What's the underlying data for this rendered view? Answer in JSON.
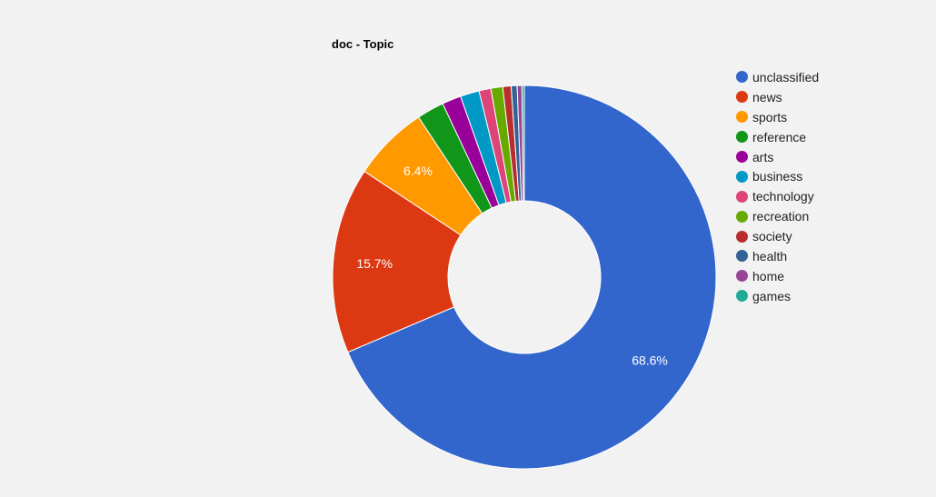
{
  "chart_data": {
    "type": "pie",
    "variant": "donut",
    "title": "doc - Topic",
    "legend_position": "right",
    "slices": [
      {
        "label": "unclassified",
        "value": 68.6,
        "color": "#3366cc",
        "data_label": "68.6%"
      },
      {
        "label": "news",
        "value": 15.7,
        "color": "#dc3912",
        "data_label": "15.7%"
      },
      {
        "label": "sports",
        "value": 6.4,
        "color": "#ff9900",
        "data_label": "6.4%"
      },
      {
        "label": "reference",
        "value": 2.3,
        "color": "#109618",
        "data_label": ""
      },
      {
        "label": "arts",
        "value": 1.6,
        "color": "#990099",
        "data_label": ""
      },
      {
        "label": "business",
        "value": 1.6,
        "color": "#0099c6",
        "data_label": ""
      },
      {
        "label": "technology",
        "value": 1.0,
        "color": "#dd4477",
        "data_label": ""
      },
      {
        "label": "recreation",
        "value": 1.0,
        "color": "#66aa00",
        "data_label": ""
      },
      {
        "label": "society",
        "value": 0.7,
        "color": "#b82e2e",
        "data_label": ""
      },
      {
        "label": "health",
        "value": 0.5,
        "color": "#316395",
        "data_label": ""
      },
      {
        "label": "home",
        "value": 0.4,
        "color": "#994499",
        "data_label": ""
      },
      {
        "label": "games",
        "value": 0.2,
        "color": "#22aa99",
        "data_label": ""
      }
    ]
  }
}
